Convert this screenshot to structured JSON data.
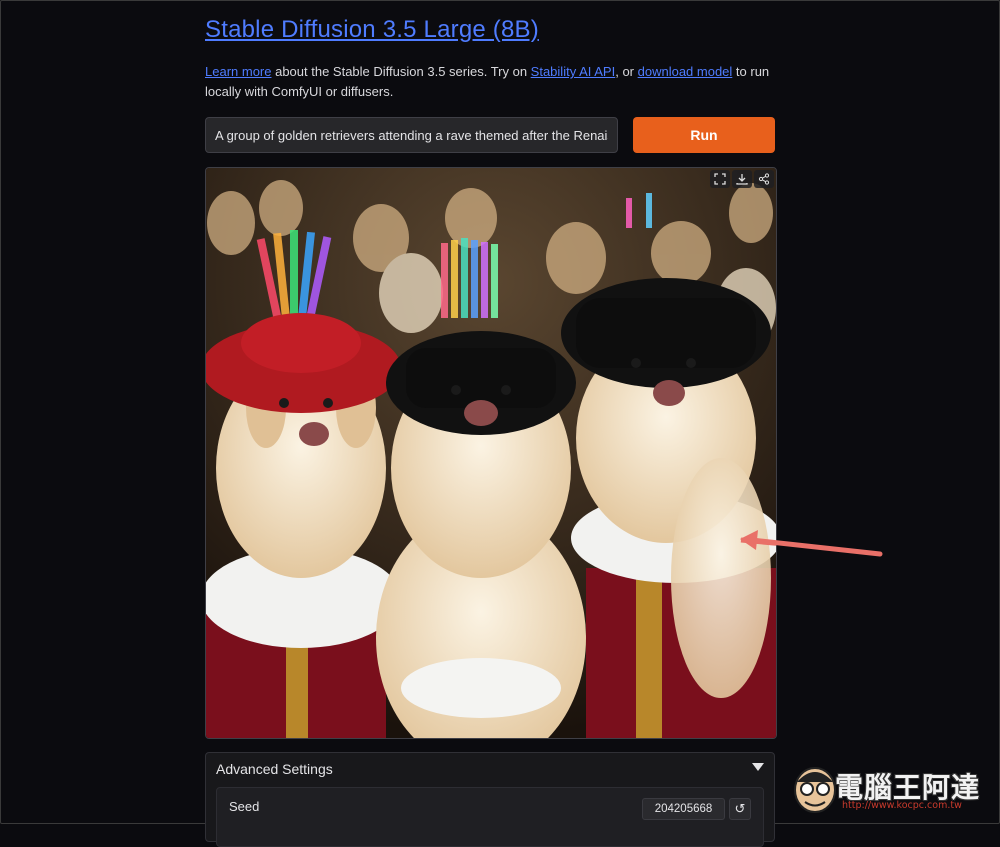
{
  "header": {
    "title": "Stable Diffusion 3.5 Large (8B)"
  },
  "description": {
    "learn_more": "Learn more",
    "text1": " about the Stable Diffusion 3.5 series. Try on ",
    "stability_link": "Stability AI API",
    "text2": ", or ",
    "download_link": "download model",
    "text3": " to run locally with ComfyUI or diffusers."
  },
  "prompt": {
    "value": "A group of golden retrievers attending a rave themed after the Renaissance"
  },
  "run_button": {
    "label": "Run"
  },
  "image_toolbar": {
    "icons": [
      "fullscreen-icon",
      "download-icon",
      "share-icon"
    ]
  },
  "advanced": {
    "label": "Advanced Settings",
    "seed_label": "Seed",
    "seed_value": "204205668",
    "reset_glyph": "↺"
  },
  "watermark": {
    "text": "電腦王阿達",
    "url": "http://www.kocpc.com.tw"
  },
  "colors": {
    "accent": "#e8601c",
    "link": "#4f7cff",
    "background": "#0b0b0f"
  }
}
